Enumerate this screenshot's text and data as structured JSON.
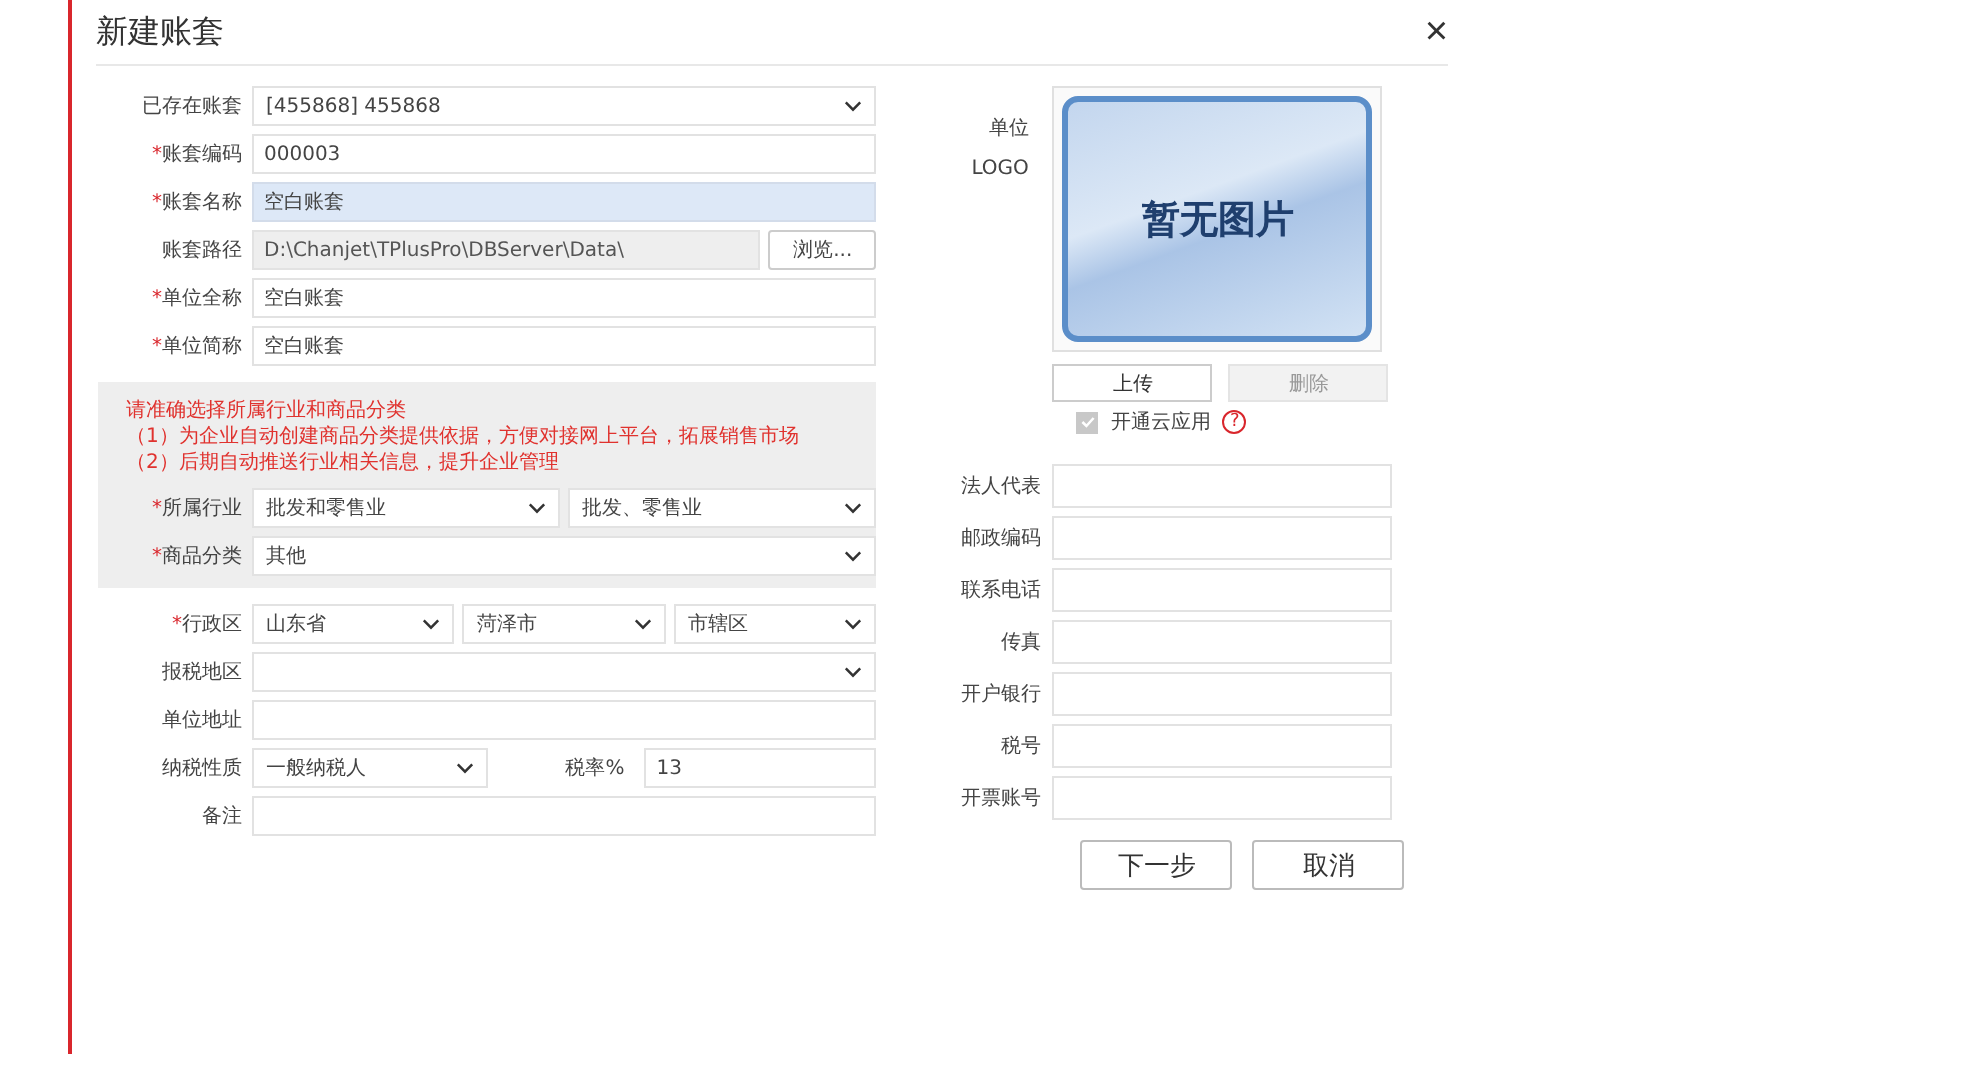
{
  "window": {
    "title": "新建账套",
    "close": "×"
  },
  "left_rows": [
    {
      "label": "已存在账套",
      "cells": [
        {
          "kind": "select",
          "value": "[455868] 455868"
        }
      ]
    },
    {
      "marker": "*",
      "label": "账套编码",
      "cells": [
        {
          "kind": "input",
          "value": "000003"
        }
      ]
    },
    {
      "marker": "*",
      "label": "账套名称",
      "cells": [
        {
          "kind": "input",
          "value": "空白账套",
          "focused": true
        }
      ]
    },
    {
      "label": "账套路径",
      "cells": [
        {
          "kind": "input",
          "value": "D:\\Chanjet\\TPlusPro\\DBServer\\Data\\",
          "disabled": true
        },
        {
          "kind": "button",
          "text": "浏览..."
        }
      ]
    },
    {
      "marker": "*",
      "label": "单位全称",
      "cells": [
        {
          "kind": "input",
          "value": "空白账套"
        }
      ]
    },
    {
      "marker": "*",
      "label": "单位简称",
      "cells": [
        {
          "kind": "input",
          "value": "空白账套"
        }
      ]
    }
  ],
  "notice": {
    "heading": "请准确选择所属行业和商品分类",
    "points": [
      "（1）为企业自动创建商品分类提供依据，方便对接网上平台，拓展销售市场",
      "（2）后期自动推送行业相关信息，提升企业管理"
    ],
    "rows": [
      {
        "marker": "*",
        "label": "所属行业",
        "cells": [
          {
            "kind": "select",
            "value": "批发和零售业"
          },
          {
            "kind": "select",
            "value": "批发、零售业"
          }
        ]
      },
      {
        "marker": "*",
        "label": "商品分类",
        "cells": [
          {
            "kind": "select",
            "value": "其他"
          }
        ]
      }
    ]
  },
  "bottom_rows": [
    {
      "marker": "*",
      "label": "行政区",
      "cells": [
        {
          "kind": "select",
          "value": "山东省"
        },
        {
          "kind": "select",
          "value": "菏泽市"
        },
        {
          "kind": "select",
          "value": "市辖区"
        }
      ]
    },
    {
      "label": "报税地区",
      "cells": [
        {
          "kind": "select"
        }
      ]
    },
    {
      "label": "单位地址",
      "cells": [
        {
          "kind": "input"
        }
      ]
    },
    {
      "label": "纳税性质",
      "cells": [
        {
          "kind": "select",
          "value": "一般纳税人"
        },
        {
          "kind": "label",
          "text": "税率%"
        },
        {
          "kind": "input",
          "value": "13"
        }
      ]
    },
    {
      "label": "备注",
      "cells": [
        {
          "kind": "input"
        }
      ]
    }
  ],
  "logo": {
    "label_lines": [
      "单位",
      "LOGO"
    ],
    "placeholder": "暂无图片",
    "upload": {
      "text": "上传",
      "disabled": false
    },
    "delete": {
      "text": "删除",
      "disabled": true
    }
  },
  "cloud": {
    "label": "开通云应用",
    "checked": true,
    "disabled": true,
    "help": "?"
  },
  "right_fields": [
    {
      "label": "法人代表"
    },
    {
      "label": "邮政编码"
    },
    {
      "label": "联系电话"
    },
    {
      "label": "传真"
    },
    {
      "label": "开户银行"
    },
    {
      "label": "税号"
    },
    {
      "label": "开票账号"
    }
  ],
  "buttons": [
    "下一步",
    "取消"
  ]
}
